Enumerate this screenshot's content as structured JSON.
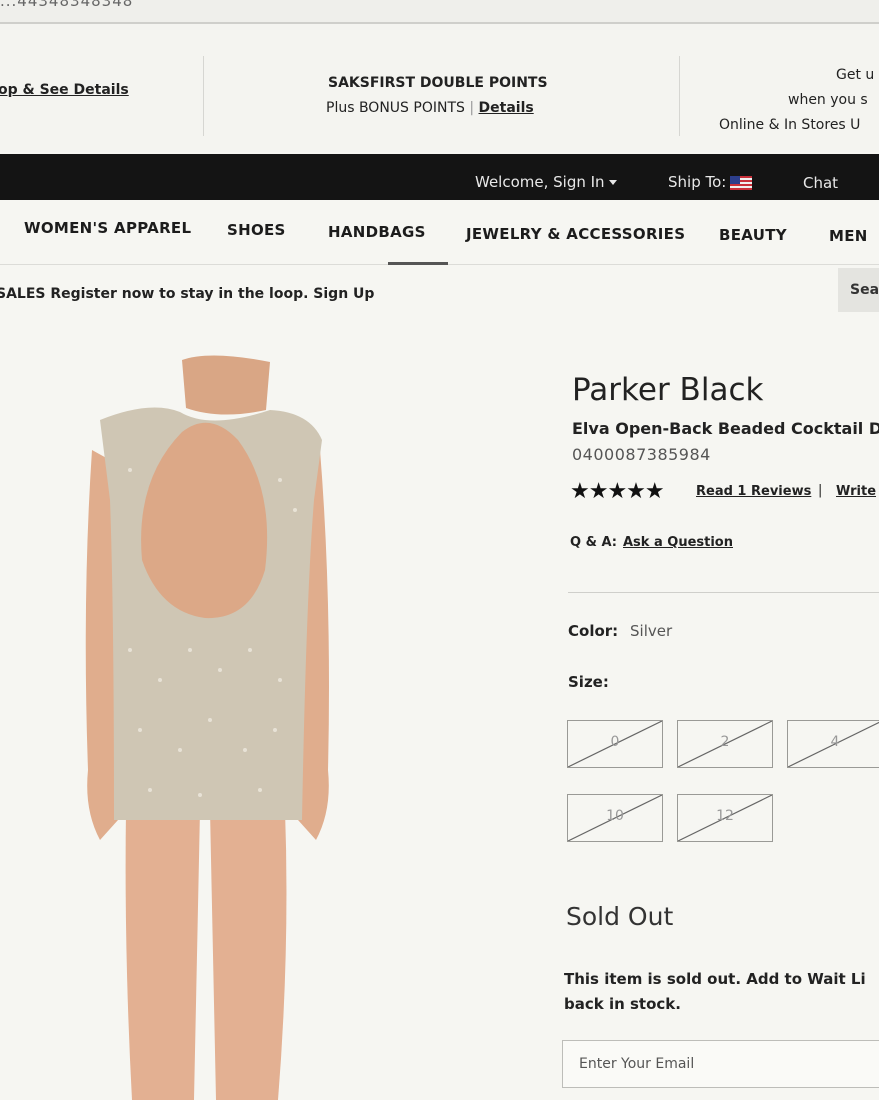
{
  "browser": {
    "url_fragment": "...44348348348"
  },
  "promo": {
    "left_link": "op & See Details",
    "center_title": "SAKSFIRST DOUBLE POINTS",
    "center_subtitle": "Plus BONUS POINTS",
    "center_link": "Details",
    "right_line1": "Get u",
    "right_line2": "when you s",
    "right_line3": "Online & In Stores U"
  },
  "utility": {
    "welcome": "Welcome, Sign In",
    "ship_to": "Ship To:",
    "chat": "Chat"
  },
  "categories": [
    "WOMEN'S APPAREL",
    "SHOES",
    "HANDBAGS",
    "JEWELRY & ACCESSORIES",
    "BEAUTY",
    "MEN"
  ],
  "signup": {
    "text": "SALES Register now to stay in the loop. Sign Up"
  },
  "search": {
    "label": "Sea"
  },
  "product": {
    "brand": "Parker Black",
    "name": "Elva Open-Back Beaded Cocktail D",
    "sku": "0400087385984",
    "rating_stars": "★★★★★",
    "rating_value": 5,
    "read_reviews": "Read 1 Reviews",
    "review_separator": "|",
    "write_review": "Write",
    "qa_label": "Q & A:",
    "qa_link": "Ask a Question",
    "color_label": "Color:",
    "color_value": "Silver",
    "size_label": "Size:",
    "sizes": [
      "0",
      "2",
      "4",
      "10",
      "12"
    ],
    "sizes_available": false,
    "availability": "Sold Out",
    "sold_message_line1": "This item is sold out. Add to Wait Li",
    "sold_message_line2": "back in stock.",
    "email_placeholder": "Enter Your Email"
  },
  "colors": {
    "nav_bg": "#141414",
    "page_bg": "#f6f6f2",
    "dress": "#cfc6b4",
    "skin": "#e2b296"
  }
}
